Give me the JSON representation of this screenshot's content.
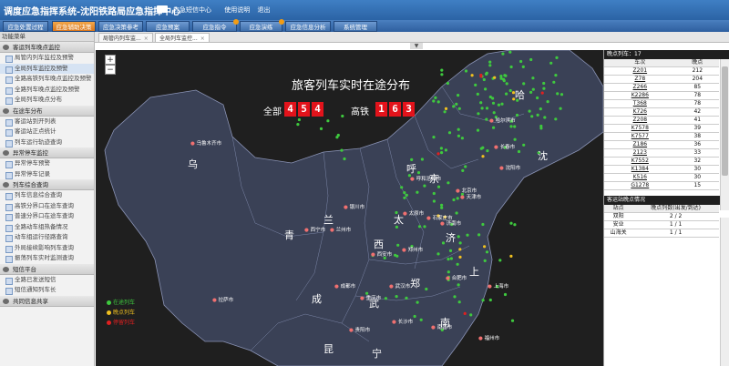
{
  "header": {
    "title": "调度应急指挥系统-沈阳铁路局应急指挥中心",
    "links": [
      "应急短信中心",
      "使用说明",
      "退出"
    ]
  },
  "nav": {
    "tabs": [
      "应急处置过程",
      "应急辅助决策",
      "应急决策参考",
      "应急预案",
      "应急指令",
      "应急演练",
      "应急信息分析",
      "系统管理"
    ]
  },
  "sidebar": {
    "title": "功能菜单",
    "sections": [
      {
        "label": "客运列车晚点监控",
        "items": [
          "局管内列车监控及预警",
          "全局列车监控及预警",
          "全路高铁列车晚点监控及预警",
          "全路列车晚点监控及预警",
          "全局列车晚点分布"
        ]
      },
      {
        "label": "在途车分布",
        "items": [
          "客运站到开列表",
          "客运站正点统计",
          "列车运行轨迹查询"
        ]
      },
      {
        "label": "异常停车监控",
        "items": [
          "异常停车预警",
          "异常停车记录"
        ]
      },
      {
        "label": "列车综合查询",
        "items": [
          "列车信息综合查询",
          "高铁分界口在途车查询",
          "普速分界口在途车查询",
          "全路动车组热备情况",
          "动车组运行径路查询",
          "外局接续影响列车查询",
          "振荡列车实时监测查询"
        ]
      },
      {
        "label": "短信平台",
        "items": [
          "全路已发送短信",
          "短信通知列车长"
        ]
      },
      {
        "label": "共同信息共享",
        "items": []
      }
    ]
  },
  "tabs2": [
    "局管内列车监...",
    "全局列车监控..."
  ],
  "map": {
    "title": "旅客列车实时在途分布",
    "total_label": "全部",
    "total_digits": [
      "4",
      "5",
      "4"
    ],
    "hsr_label": "高铁",
    "hsr_digits": [
      "1",
      "6",
      "3"
    ],
    "provinces": [
      "乌",
      "呼",
      "哈",
      "沈",
      "京",
      "青",
      "兰",
      "太",
      "济",
      "西",
      "郑",
      "成",
      "武",
      "南",
      "上",
      "昆",
      "宁"
    ],
    "cities": [
      "乌鲁木齐市",
      "哈尔滨市",
      "长春市",
      "沈阳市",
      "呼和浩特市",
      "北京市",
      "天津市",
      "银川市",
      "兰州市",
      "太原市",
      "石家庄市",
      "济南市",
      "西宁市",
      "西安市",
      "郑州市",
      "合肥市",
      "拉萨市",
      "成都市",
      "重庆市",
      "武汉市",
      "上海市",
      "长沙市",
      "南昌市",
      "贵阳市",
      "福州市"
    ],
    "legend": [
      {
        "label": "在途列车",
        "color": "#3ec93e"
      },
      {
        "label": "晚点列车",
        "color": "#f0c020"
      },
      {
        "label": "停留列车",
        "color": "#e02020"
      }
    ]
  },
  "trains_panel": {
    "title": "晚点列车：17",
    "headers": [
      "车次",
      "晚点"
    ],
    "rows": [
      {
        "train": "Z201",
        "delay": "212"
      },
      {
        "train": "Z78",
        "delay": "204"
      },
      {
        "train": "Z266",
        "delay": "85"
      },
      {
        "train": "K2286",
        "delay": "78"
      },
      {
        "train": "T368",
        "delay": "78"
      },
      {
        "train": "K726",
        "delay": "42"
      },
      {
        "train": "Z208",
        "delay": "41"
      },
      {
        "train": "K7578",
        "delay": "39"
      },
      {
        "train": "K7577",
        "delay": "38"
      },
      {
        "train": "Z186",
        "delay": "36"
      },
      {
        "train": "2123",
        "delay": "33"
      },
      {
        "train": "K7552",
        "delay": "32"
      },
      {
        "train": "K1384",
        "delay": "30"
      },
      {
        "train": "K516",
        "delay": "30"
      },
      {
        "train": "G1278",
        "delay": "15"
      }
    ]
  },
  "station_panel": {
    "title": "客运站晚点情况",
    "headers": [
      "站点",
      "晚点列数(出发/到达)"
    ],
    "rows": [
      {
        "station": "双阳",
        "count": "2 / 2"
      },
      {
        "station": "安业",
        "count": "1 / 1"
      },
      {
        "station": "山海关",
        "count": "1 / 1"
      }
    ]
  }
}
